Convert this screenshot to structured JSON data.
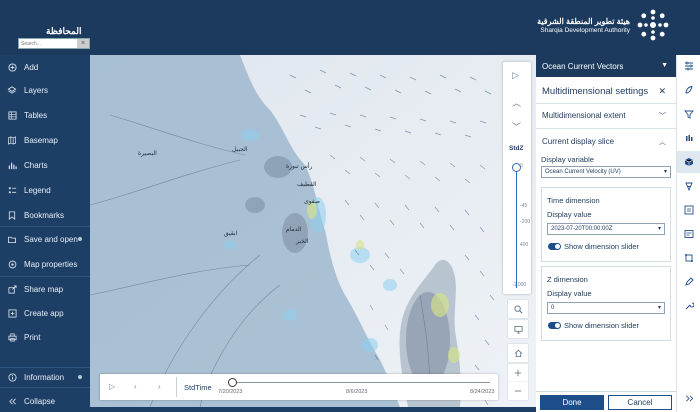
{
  "header": {
    "title": "المحافظة",
    "search_placeholder": "Search...",
    "logo": {
      "name_ar": "هيئة تطوير المنطقة الشرقية",
      "name_en": "Sharqia Development Authority"
    }
  },
  "nav": {
    "items": [
      {
        "label": "Add",
        "icon": "plus-circle-icon"
      },
      {
        "label": "Layers",
        "icon": "layers-icon"
      },
      {
        "label": "Tables",
        "icon": "table-icon"
      },
      {
        "label": "Basemap",
        "icon": "basemap-icon"
      },
      {
        "label": "Charts",
        "icon": "chart-icon"
      },
      {
        "label": "Legend",
        "icon": "legend-icon"
      },
      {
        "label": "Bookmarks",
        "icon": "bookmark-icon"
      },
      {
        "label": "Save and open",
        "icon": "folder-icon"
      },
      {
        "label": "Map properties",
        "icon": "map-properties-icon"
      },
      {
        "label": "Share map",
        "icon": "share-icon"
      },
      {
        "label": "Create app",
        "icon": "create-app-icon"
      },
      {
        "label": "Print",
        "icon": "print-icon"
      },
      {
        "label": "Information",
        "icon": "info-icon"
      },
      {
        "label": "Collapse",
        "icon": "collapse-icon"
      }
    ]
  },
  "map": {
    "labels": [
      "الجبيل",
      "البصيرة",
      "رأس تنورة",
      "القطيف",
      "الدمام",
      "الخبر",
      "صفوى",
      "ابقيق"
    ],
    "dimension_slider": {
      "label": "StdZ",
      "ticks": [
        "0",
        "-45",
        "-200",
        "400",
        "-1,000"
      ]
    },
    "time_slider": {
      "label": "StdTime",
      "dates": [
        "7/20/2023",
        "8/6/2023",
        "8/24/2023"
      ]
    }
  },
  "panel": {
    "layer_name": "Ocean Current Vectors",
    "title": "Multidimensional settings",
    "extent_label": "Multidimensional extent",
    "slice_label": "Current display slice",
    "display_variable_label": "Display variable",
    "display_variable_value": "Ocean Current Velocity (UV)",
    "time_dimension": {
      "heading": "Time dimension",
      "value_label": "Display value",
      "value": "2023-07-20T00:00:00Z",
      "toggle_label": "Show dimension slider"
    },
    "z_dimension": {
      "heading": "Z dimension",
      "value_label": "Display value",
      "value": "0",
      "toggle_label": "Show dimension slider"
    },
    "done_label": "Done",
    "cancel_label": "Cancel"
  },
  "right_toolbar": [
    "properties-icon",
    "styles-icon",
    "filter-icon",
    "effects-icon",
    "multidimensional-icon",
    "clustering-icon",
    "pop-ups-icon",
    "fields-icon",
    "labels-icon",
    "configure-icon",
    "collapse-icon"
  ]
}
